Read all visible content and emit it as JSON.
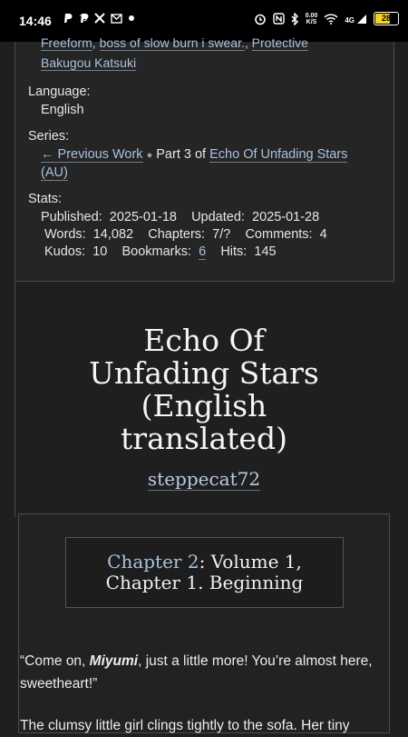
{
  "status_bar": {
    "time": "14:46",
    "left_icons": [
      "p-app-icon",
      "p-app-icon",
      "x-icon",
      "mail-icon",
      "dot"
    ],
    "network_speed_top": "0.00",
    "network_speed_bottom": "K/S",
    "network_type": "4G",
    "battery": "28"
  },
  "tags": {
    "line1": [
      "Freeform",
      "boss of slow burn i swear.",
      "Protective"
    ],
    "line2": [
      "Bakugou Katsuki"
    ]
  },
  "language": {
    "label": "Language:",
    "value": "English"
  },
  "series": {
    "label": "Series:",
    "previous": "← Previous Work",
    "part": "Part 3 of",
    "name_line1": "Echo Of Unfading Stars",
    "name_line2": "(AU)"
  },
  "stats": {
    "label": "Stats:",
    "published_label": "Published:",
    "published": "2025-01-18",
    "updated_label": "Updated:",
    "updated": "2025-01-28",
    "words_label": "Words:",
    "words": "14,082",
    "chapters_label": "Chapters:",
    "chapters": "7/?",
    "comments_label": "Comments:",
    "comments": "4",
    "kudos_label": "Kudos:",
    "kudos": "10",
    "bookmarks_label": "Bookmarks:",
    "bookmarks": "6",
    "hits_label": "Hits:",
    "hits": "145"
  },
  "work": {
    "title_lines": [
      "Echo Of",
      "Unfading Stars",
      "(English",
      "translated)"
    ],
    "author": "steppecat72"
  },
  "chapter": {
    "link": "Chapter 2",
    "rest_line1": ": Volume 1,",
    "line2": "Chapter 1. Beginning"
  },
  "body": {
    "p1_before": "“Come on, ",
    "p1_em": "Miyumi",
    "p1_after": ", just a little more! You’re almost here, sweetheart!”",
    "p2": "The clumsy little girl clings tightly to the sofa. Her tiny"
  }
}
